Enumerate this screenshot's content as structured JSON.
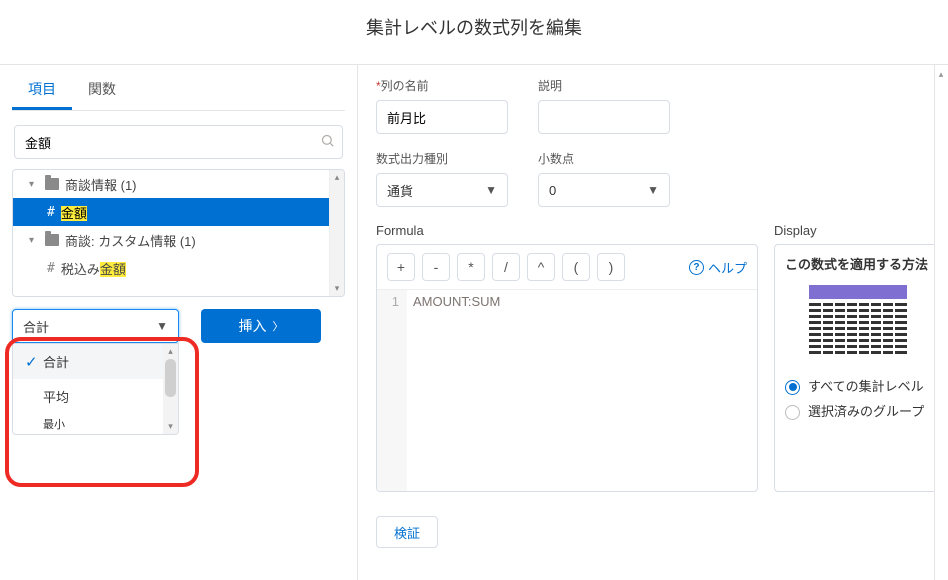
{
  "title": "集計レベルの数式列を編集",
  "left": {
    "tabs": {
      "items": [
        "項目",
        "関数"
      ],
      "active": 0
    },
    "search": {
      "value": "金額"
    },
    "tree": [
      {
        "kind": "folder",
        "label": "商談情報 (1)",
        "expanded": true
      },
      {
        "kind": "field",
        "label_prefix": "",
        "label_hl": "金額",
        "label_suffix": "",
        "selected": true
      },
      {
        "kind": "folder",
        "label": "商談: カスタム情報 (1)",
        "expanded": true
      },
      {
        "kind": "field",
        "label_prefix": "税込み",
        "label_hl": "金額",
        "label_suffix": "",
        "selected": false
      }
    ],
    "agg_select": {
      "value": "合計",
      "options": [
        "合計",
        "平均",
        "最小"
      ],
      "selected_index": 0
    },
    "insert_label": "挿入"
  },
  "right": {
    "col_name": {
      "label": "列の名前",
      "value": "前月比",
      "required": true
    },
    "desc": {
      "label": "説明",
      "value": ""
    },
    "output": {
      "label": "数式出力種別",
      "value": "通貨"
    },
    "decimal": {
      "label": "小数点",
      "value": "0"
    },
    "formula": {
      "label": "Formula",
      "operators": [
        "+",
        "-",
        "*",
        "/",
        "^",
        "(",
        ")"
      ],
      "help": "ヘルプ",
      "lines": [
        "AMOUNT:SUM"
      ]
    },
    "display": {
      "label": "Display",
      "title": "この数式を適用する方法",
      "radios": [
        {
          "label": "すべての集計レベル",
          "checked": true
        },
        {
          "label": "選択済みのグループ",
          "checked": false
        }
      ]
    },
    "validate": "検証"
  }
}
